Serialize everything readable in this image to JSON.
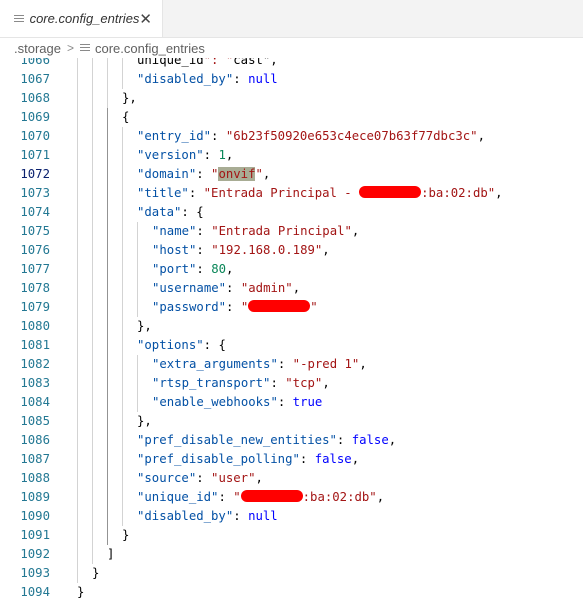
{
  "tab": {
    "title": "core.config_entries",
    "close": "✕"
  },
  "breadcrumb": {
    "folder": ".storage",
    "sep": ">",
    "file": "core.config_entries"
  },
  "lines": [
    {
      "n": "1066",
      "code": "unique_id\": \"cast\",",
      "partial": true
    },
    {
      "n": "1067",
      "code": "\"disabled_by\": null"
    },
    {
      "n": "1068",
      "code": "},"
    },
    {
      "n": "1069",
      "code": "{"
    },
    {
      "n": "1070",
      "code": "\"entry_id\": \"6b23f50920e653c4ece07b63f77dbc3c\","
    },
    {
      "n": "1071",
      "code": "\"version\": 1,"
    },
    {
      "n": "1072",
      "code": "\"domain\": \"onvif\",",
      "active": true
    },
    {
      "n": "1073",
      "code": "\"title\": \"Entrada Principal - [redacted]:ba:02:db\","
    },
    {
      "n": "1074",
      "code": "\"data\": {"
    },
    {
      "n": "1075",
      "code": "\"name\": \"Entrada Principal\","
    },
    {
      "n": "1076",
      "code": "\"host\": \"192.168.0.189\","
    },
    {
      "n": "1077",
      "code": "\"port\": 80,"
    },
    {
      "n": "1078",
      "code": "\"username\": \"admin\","
    },
    {
      "n": "1079",
      "code": "\"password\": \"[redacted]\""
    },
    {
      "n": "1080",
      "code": "},"
    },
    {
      "n": "1081",
      "code": "\"options\": {"
    },
    {
      "n": "1082",
      "code": "\"extra_arguments\": \"-pred 1\","
    },
    {
      "n": "1083",
      "code": "\"rtsp_transport\": \"tcp\","
    },
    {
      "n": "1084",
      "code": "\"enable_webhooks\": true"
    },
    {
      "n": "1085",
      "code": "},"
    },
    {
      "n": "1086",
      "code": "\"pref_disable_new_entities\": false,"
    },
    {
      "n": "1087",
      "code": "\"pref_disable_polling\": false,"
    },
    {
      "n": "1088",
      "code": "\"source\": \"user\","
    },
    {
      "n": "1089",
      "code": "\"unique_id\": \"[redacted]:ba:02:db\","
    },
    {
      "n": "1090",
      "code": "\"disabled_by\": null"
    },
    {
      "n": "1091",
      "code": "}"
    },
    {
      "n": "1092",
      "code": "]"
    },
    {
      "n": "1093",
      "code": "}"
    },
    {
      "n": "1094",
      "code": "}"
    }
  ],
  "colors": {
    "key": "#0451a5",
    "string": "#a31515",
    "number": "#098658",
    "keyword": "#0000ff",
    "line_number": "#237893",
    "redaction": "#ff0000",
    "match_highlight": "#a8ac94"
  },
  "icons": [
    "file-lines-icon",
    "close-icon",
    "chevron-right-icon"
  ]
}
